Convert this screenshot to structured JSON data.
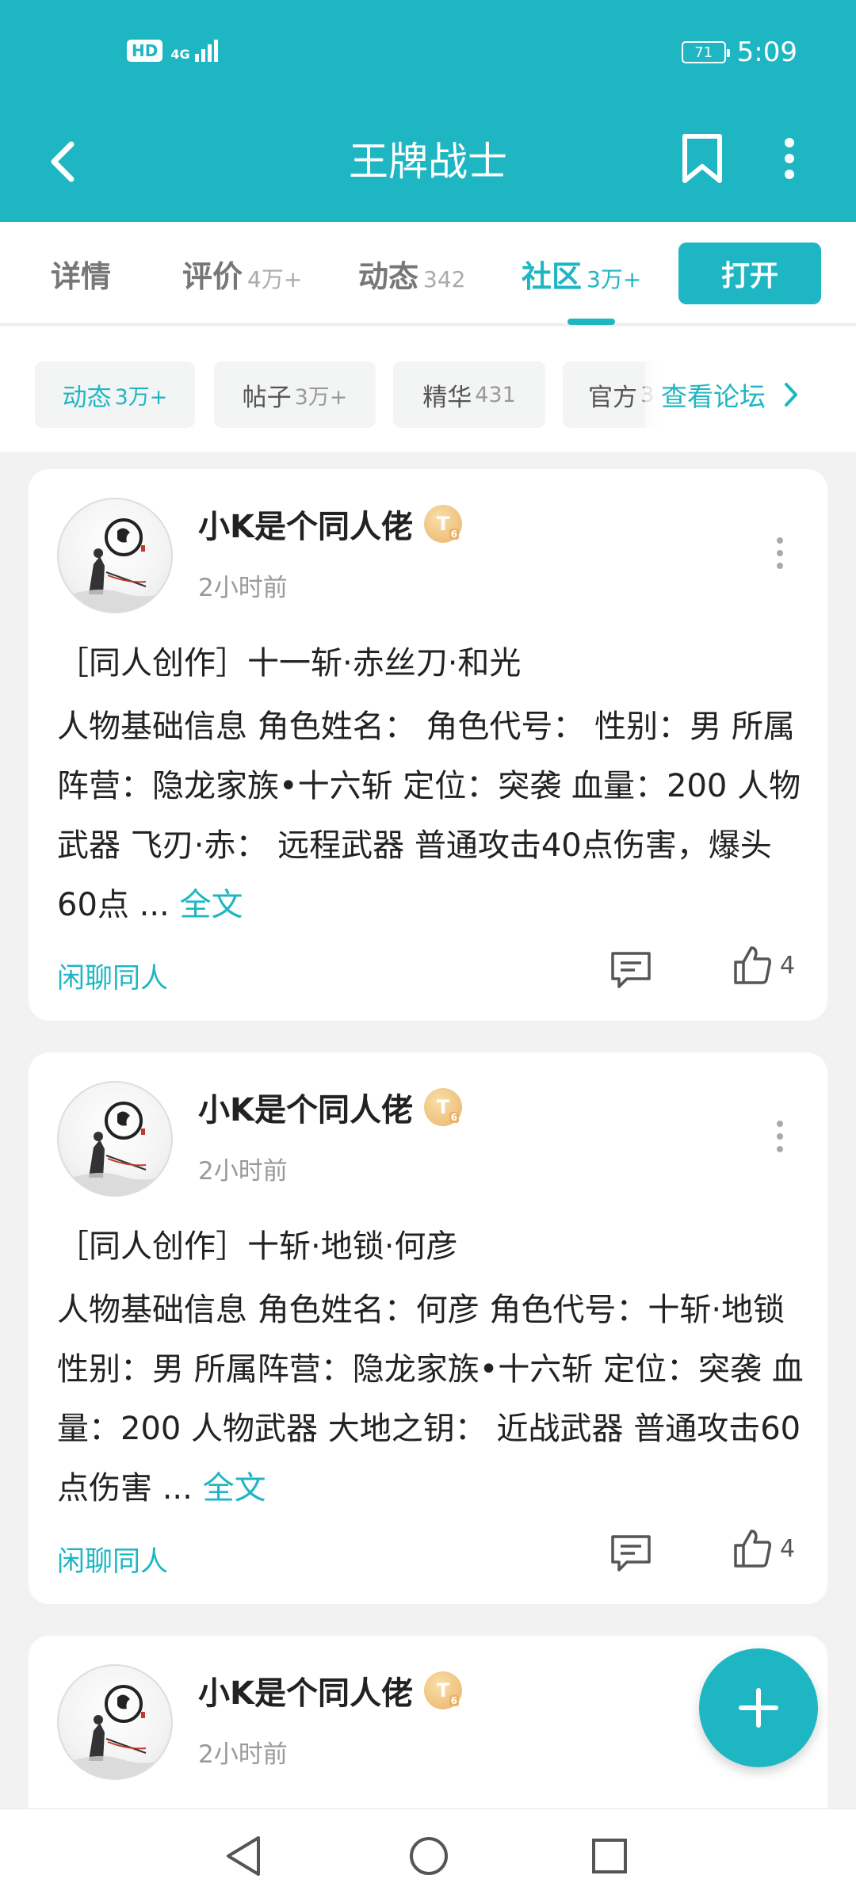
{
  "status_bar": {
    "hd_badge": "HD",
    "network": "4G",
    "battery": "71",
    "time": "5:09"
  },
  "header": {
    "title": "王牌战士",
    "brand_color": "#1fb6c3"
  },
  "tabs": [
    {
      "label": "详情",
      "count": ""
    },
    {
      "label": "评价",
      "count": "4万+"
    },
    {
      "label": "动态",
      "count": "342"
    },
    {
      "label": "社区",
      "count": "3万+",
      "active": true
    }
  ],
  "open_button": "打开",
  "filters": {
    "chips": [
      {
        "label": "动态",
        "count": "3万+",
        "active": true
      },
      {
        "label": "帖子",
        "count": "3万+"
      },
      {
        "label": "精华",
        "count": "431"
      },
      {
        "label": "官方",
        "count": "3"
      }
    ],
    "forum_link": "查看论坛"
  },
  "posts": [
    {
      "username": "小K是个同人佬",
      "badge": "T",
      "badge_level": "6",
      "time": "2小时前",
      "title": "［同人创作］十一斩·赤丝刀·和光",
      "excerpt": "人物基础信息 角色姓名： 角色代号： 性别：男 所属阵营：隐龙家族•十六斩 定位：突袭 血量：200 人物武器 飞刃·赤： 远程武器 普通攻击40点伤害，爆头60点 ...",
      "full_text_link": "全文",
      "tag": "闲聊同人",
      "likes": "4"
    },
    {
      "username": "小K是个同人佬",
      "badge": "T",
      "badge_level": "6",
      "time": "2小时前",
      "title": "［同人创作］十斩·地锁·何彦",
      "excerpt": "人物基础信息 角色姓名：何彦 角色代号：十斩·地锁 性别：男 所属阵营：隐龙家族•十六斩 定位：突袭 血量：200 人物武器 大地之钥： 近战武器 普通攻击60点伤害 ...",
      "full_text_link": "全文",
      "tag": "闲聊同人",
      "likes": "4"
    },
    {
      "username": "小K是个同人佬",
      "badge": "T",
      "badge_level": "6",
      "time": "2小时前"
    }
  ]
}
